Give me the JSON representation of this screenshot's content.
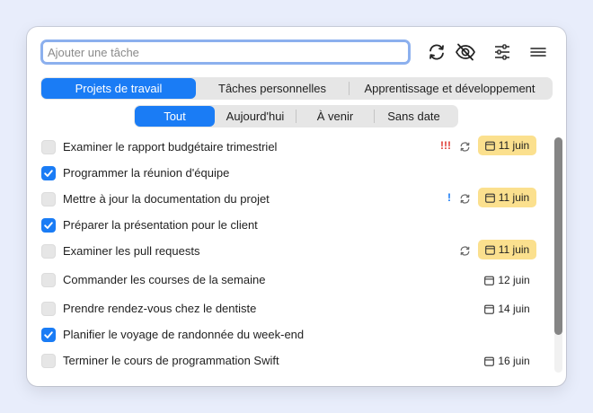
{
  "search": {
    "placeholder": "Ajouter une tâche"
  },
  "toolbar": {
    "icons": [
      "sync-icon",
      "hide-completed-icon",
      "filter-sliders-icon",
      "menu-icon"
    ]
  },
  "projects": {
    "tabs": [
      {
        "label": "Projets de travail",
        "active": true
      },
      {
        "label": "Tâches personnelles",
        "active": false
      },
      {
        "label": "Apprentissage et développement",
        "active": false
      }
    ]
  },
  "filters": {
    "tabs": [
      {
        "label": "Tout",
        "active": true
      },
      {
        "label": "Aujourd'hui",
        "active": false
      },
      {
        "label": "À venir",
        "active": false
      },
      {
        "label": "Sans date",
        "active": false
      }
    ]
  },
  "tasks": [
    {
      "title": "Examiner le rapport budgétaire trimestriel",
      "done": false,
      "priority": "!!!",
      "priority_color": "#e0403a",
      "repeat": true,
      "date": "11 juin",
      "highlight": true
    },
    {
      "title": "Programmer la réunion d'équipe",
      "done": true,
      "priority": "",
      "repeat": false,
      "date": "",
      "highlight": false
    },
    {
      "title": "Mettre à jour la documentation du projet",
      "done": false,
      "priority": "!",
      "priority_color": "#1a7cf5",
      "repeat": true,
      "date": "11 juin",
      "highlight": true
    },
    {
      "title": "Préparer la présentation pour le client",
      "done": true,
      "priority": "",
      "repeat": false,
      "date": "",
      "highlight": false
    },
    {
      "title": "Examiner les pull requests",
      "done": false,
      "priority": "",
      "repeat": true,
      "date": "11 juin",
      "highlight": true
    },
    {
      "title": "Commander les courses de la semaine",
      "done": false,
      "priority": "",
      "repeat": false,
      "date": "12 juin",
      "highlight": false
    },
    {
      "title": "Prendre rendez-vous chez le dentiste",
      "done": false,
      "priority": "",
      "repeat": false,
      "date": "14 juin",
      "highlight": false
    },
    {
      "title": "Planifier le voyage de randonnée du week-end",
      "done": true,
      "priority": "",
      "repeat": false,
      "date": "",
      "highlight": false
    },
    {
      "title": "Terminer le cours de programmation Swift",
      "done": false,
      "priority": "",
      "repeat": false,
      "date": "16 juin",
      "highlight": false
    }
  ],
  "colors": {
    "accent": "#1a7cf5",
    "date_highlight": "#fbe08e",
    "priority_high": "#e0403a"
  }
}
